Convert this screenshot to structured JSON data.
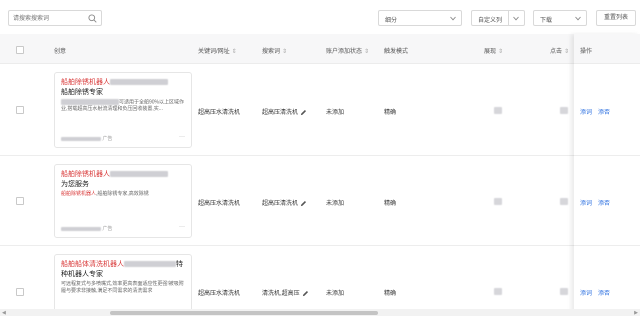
{
  "toolbar": {
    "search_placeholder": "请搜索搜索词",
    "field_dropdown": "细分",
    "columns_button": "自定义列",
    "download_button": "下载",
    "reset_sort_button": "重置列表"
  },
  "table": {
    "headers": {
      "creative": "创意",
      "keyword": "关键词/网址",
      "search_term": "搜索词",
      "add_status": "账户添加状态",
      "trigger_mode": "触发模式",
      "impressions": "展现",
      "clicks": "点击",
      "action": "操作"
    },
    "rows": [
      {
        "title_red": "船舶除锈机器人",
        "title_dark": "船舶除锈专家",
        "desc": "可适用于全船90%以上区域作业,搭载超高压水射流清理和负压回收装置,实...",
        "meta": "广告",
        "keyword": "超高压水清洗机",
        "search_term": "超高压清洗机",
        "add_status": "未添加",
        "trigger_mode": "精确",
        "action_add": "添词",
        "action_negative": "添否"
      },
      {
        "title_red": "船舶除锈机器人",
        "title_dark": "为您服务",
        "desc_red": "船舶除锈机器人",
        "desc": ",船舶除锈专家,高效除锈",
        "meta": "广告",
        "keyword": "超高压水清洗机",
        "search_term": "超高压清洗机",
        "add_status": "未添加",
        "trigger_mode": "精确",
        "action_add": "添词",
        "action_negative": "添否"
      },
      {
        "title_red": "船舶船体清洗机器人",
        "title_suffix": "特",
        "title_dark": "种机器人专家",
        "desc": "可远程复式与多喷嘴式,效率更高表面适应性更强!被吸附履与要求非接触,满足不同需求的清洗需求",
        "keyword": "超高压水清洗机",
        "search_term": "清洗机,超高压",
        "add_status": "未添加",
        "trigger_mode": "精确",
        "action_add": "添词",
        "action_negative": "添否"
      }
    ]
  },
  "colors": {
    "accent_link": "#2b6fe0",
    "title_red": "#d93a3a",
    "header_bg": "#f7f7f8"
  }
}
